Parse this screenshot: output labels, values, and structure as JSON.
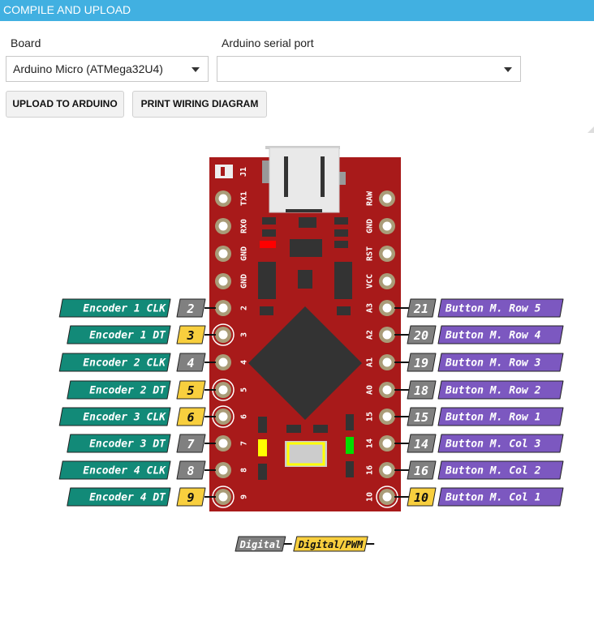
{
  "header": {
    "title": "COMPILE AND UPLOAD"
  },
  "board": {
    "label": "Board",
    "value": "Arduino Micro (ATMega32U4)"
  },
  "serial": {
    "label": "Arduino serial port",
    "value": ""
  },
  "buttons": {
    "upload": "UPLOAD TO ARDUINO",
    "print": "PRINT WIRING DIAGRAM"
  },
  "colors": {
    "header": "#41b0e1",
    "board": "#a81a1a",
    "encoder": "#128a78",
    "button_matrix": "#7c58c0",
    "digital": "#808080",
    "pwm": "#f8cf3e"
  },
  "diagram": {
    "jumper_label": "J1",
    "left_pins": [
      {
        "pin": "TX1"
      },
      {
        "pin": "RX0"
      },
      {
        "pin": "GND"
      },
      {
        "pin": "GND"
      },
      {
        "pin": "2",
        "num": "2",
        "type": "digital",
        "func": "Encoder 1 CLK"
      },
      {
        "pin": "3",
        "num": "3",
        "type": "pwm",
        "func": "Encoder 1 DT"
      },
      {
        "pin": "4",
        "num": "4",
        "type": "digital",
        "func": "Encoder 2 CLK"
      },
      {
        "pin": "5",
        "num": "5",
        "type": "pwm",
        "func": "Encoder 2 DT"
      },
      {
        "pin": "6",
        "num": "6",
        "type": "pwm",
        "func": "Encoder 3 CLK"
      },
      {
        "pin": "7",
        "num": "7",
        "type": "digital",
        "func": "Encoder 3 DT"
      },
      {
        "pin": "8",
        "num": "8",
        "type": "digital",
        "func": "Encoder 4 CLK"
      },
      {
        "pin": "9",
        "num": "9",
        "type": "pwm",
        "func": "Encoder 4 DT"
      }
    ],
    "right_pins": [
      {
        "pin": "RAW"
      },
      {
        "pin": "GND"
      },
      {
        "pin": "RST"
      },
      {
        "pin": "VCC"
      },
      {
        "pin": "A3",
        "num": "21",
        "type": "digital",
        "func": "Button M. Row 5"
      },
      {
        "pin": "A2",
        "num": "20",
        "type": "digital",
        "func": "Button M. Row 4"
      },
      {
        "pin": "A1",
        "num": "19",
        "type": "digital",
        "func": "Button M. Row 3"
      },
      {
        "pin": "A0",
        "num": "18",
        "type": "digital",
        "func": "Button M. Row 2"
      },
      {
        "pin": "15",
        "num": "15",
        "type": "digital",
        "func": "Button M. Row 1"
      },
      {
        "pin": "14",
        "num": "14",
        "type": "digital",
        "func": "Button M. Col 3"
      },
      {
        "pin": "16",
        "num": "16",
        "type": "digital",
        "func": "Button M. Col 2"
      },
      {
        "pin": "10",
        "num": "10",
        "type": "pwm",
        "func": "Button M. Col 1"
      }
    ],
    "legend": [
      {
        "label": "Digital",
        "type": "digital"
      },
      {
        "label": "Digital/PWM",
        "type": "pwm"
      }
    ]
  }
}
